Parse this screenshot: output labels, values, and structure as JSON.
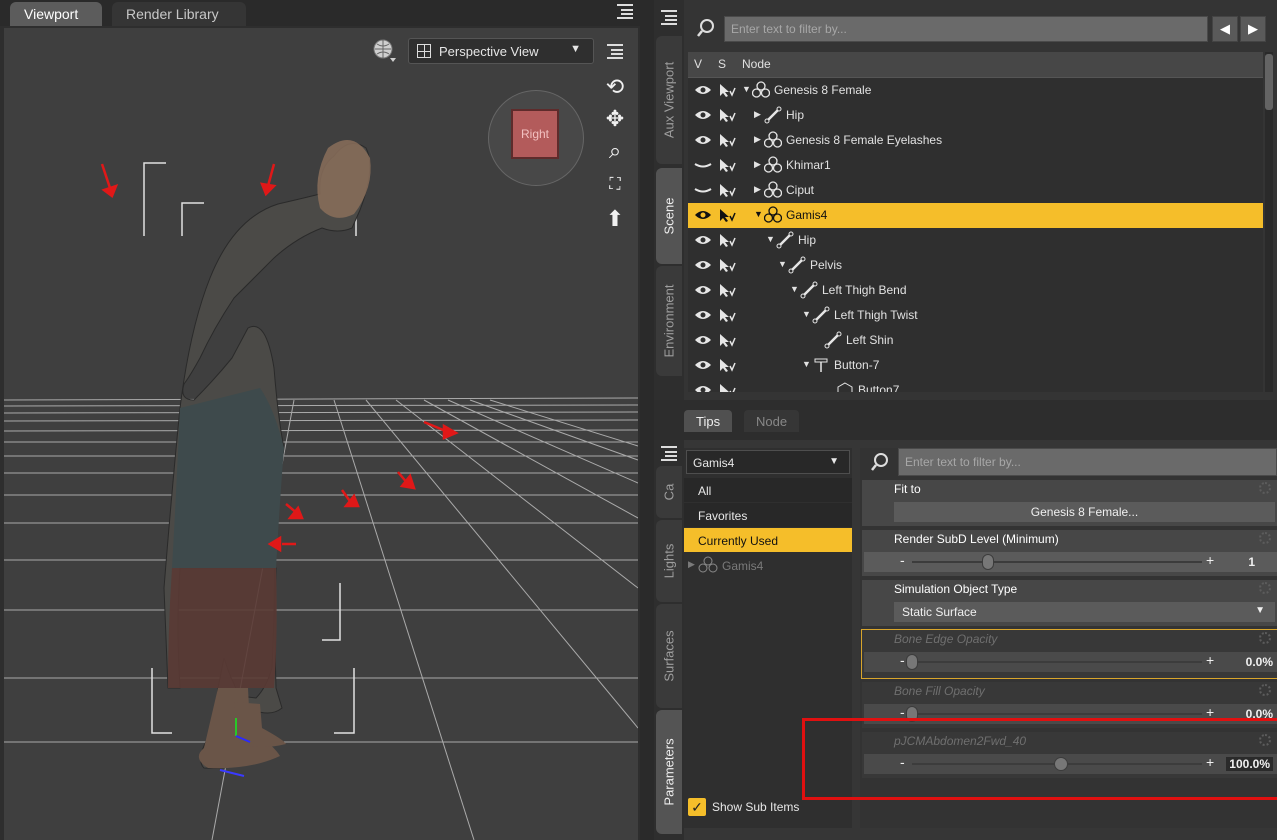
{
  "viewport": {
    "tabs": [
      {
        "label": "Viewport"
      },
      {
        "label": "Render Library"
      }
    ],
    "view_mode": "Perspective View",
    "cube_face_label": "Right"
  },
  "side_tabs_top": [
    {
      "label": "Aux Viewport"
    },
    {
      "label": "Scene"
    },
    {
      "label": "Environment"
    }
  ],
  "side_tabs_bottom": [
    {
      "label": "Ca"
    },
    {
      "label": "Lights"
    },
    {
      "label": "Surfaces"
    },
    {
      "label": "Parameters"
    }
  ],
  "scene": {
    "filter_placeholder": "Enter text to filter by...",
    "columns": {
      "v": "V",
      "s": "S",
      "node": "Node"
    },
    "rows": [
      {
        "label": "Genesis 8 Female",
        "visible": true
      },
      {
        "label": "Hip",
        "visible": true
      },
      {
        "label": "Genesis 8 Female Eyelashes",
        "visible": true
      },
      {
        "label": "Khimar1",
        "visible": false
      },
      {
        "label": "Ciput",
        "visible": false
      },
      {
        "label": "Gamis4",
        "visible": true
      },
      {
        "label": "Hip",
        "visible": true
      },
      {
        "label": "Pelvis",
        "visible": true
      },
      {
        "label": "Left Thigh Bend",
        "visible": true
      },
      {
        "label": "Left Thigh Twist",
        "visible": true
      },
      {
        "label": "Left Shin",
        "visible": true
      },
      {
        "label": "Button-7",
        "visible": true
      },
      {
        "label": "Button7",
        "visible": true
      }
    ]
  },
  "tips_tabs": [
    {
      "label": "Tips"
    },
    {
      "label": "Node"
    }
  ],
  "parameters": {
    "node_select": "Gamis4",
    "categories": [
      {
        "label": "All"
      },
      {
        "label": "Favorites"
      },
      {
        "label": "Currently Used"
      },
      {
        "label": "Gamis4"
      }
    ],
    "show_sub_items": "Show Sub Items",
    "filter_placeholder": "Enter text to filter by...",
    "props": [
      {
        "name": "Fit to",
        "button": "Genesis 8 Female..."
      },
      {
        "name": "Render SubD Level (Minimum)",
        "value": "1"
      },
      {
        "name": "Simulation Object Type",
        "dropdown": "Static Surface"
      },
      {
        "name": "Bone Edge Opacity",
        "value": "0.0%"
      },
      {
        "name": "Bone Fill Opacity",
        "value": "0.0%"
      },
      {
        "name": "pJCMAbdomen2Fwd_40",
        "value": "100.0%"
      }
    ],
    "minus": "-",
    "plus": "+"
  }
}
